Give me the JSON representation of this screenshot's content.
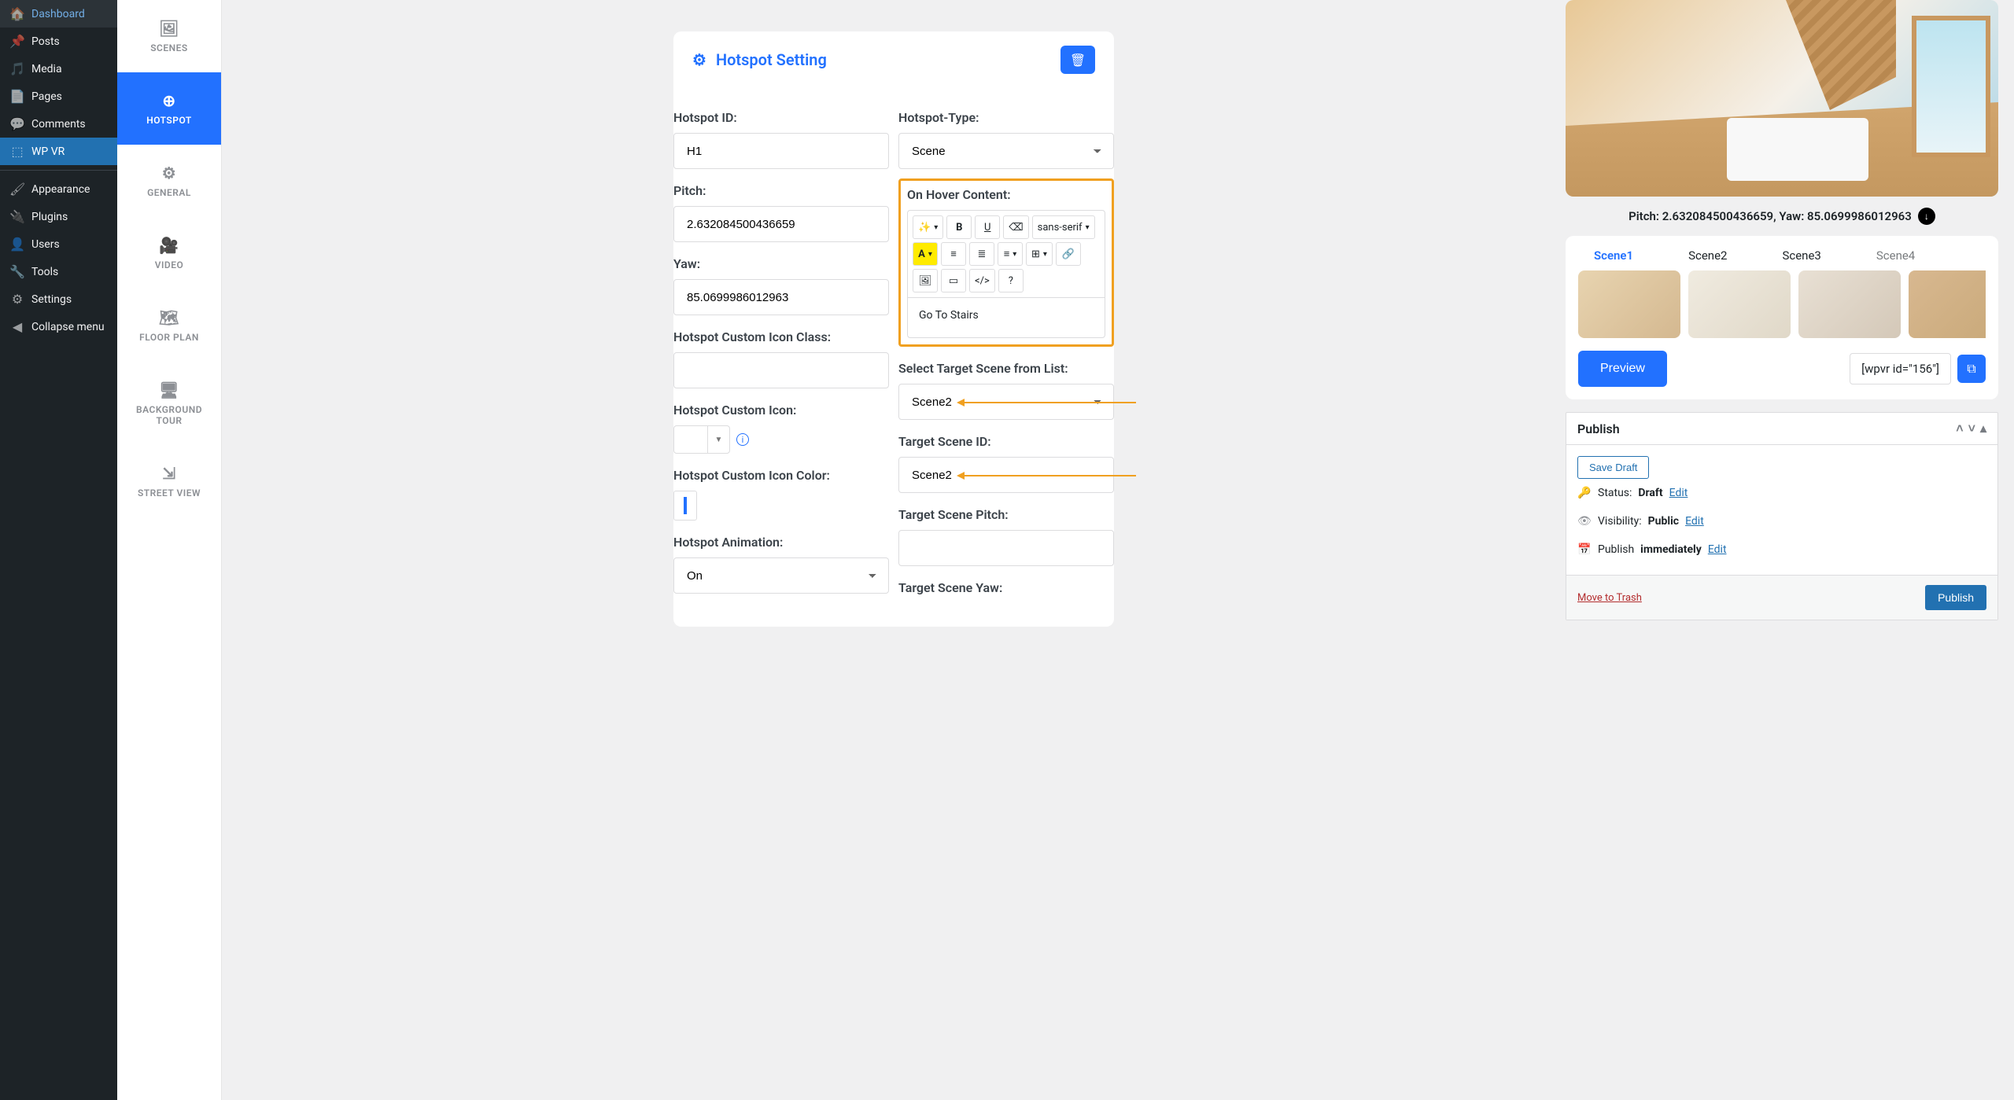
{
  "sidebar": {
    "items": [
      {
        "icon": "⌂",
        "label": "Dashboard"
      },
      {
        "icon": "📌",
        "label": "Posts"
      },
      {
        "icon": "🖼",
        "label": "Media"
      },
      {
        "icon": "📄",
        "label": "Pages"
      },
      {
        "icon": "💬",
        "label": "Comments"
      },
      {
        "icon": "⬚",
        "label": "WP VR",
        "active": true
      },
      {
        "sep": true
      },
      {
        "icon": "🖌",
        "label": "Appearance"
      },
      {
        "icon": "🔌",
        "label": "Plugins"
      },
      {
        "icon": "👤",
        "label": "Users"
      },
      {
        "icon": "🔧",
        "label": "Tools"
      },
      {
        "icon": "⚙",
        "label": "Settings"
      },
      {
        "icon": "◀",
        "label": "Collapse menu"
      }
    ]
  },
  "tabs": [
    {
      "icon": "🖼",
      "label": "SCENES"
    },
    {
      "icon": "⊕",
      "label": "HOTSPOT",
      "active": true
    },
    {
      "icon": "⚙",
      "label": "GENERAL"
    },
    {
      "icon": "🎥",
      "label": "VIDEO"
    },
    {
      "icon": "🗺",
      "label": "FLOOR PLAN"
    },
    {
      "icon": "🖥",
      "label": "BACKGROUND TOUR"
    },
    {
      "icon": "⇲",
      "label": "STREET VIEW"
    }
  ],
  "hotspot": {
    "setting_title": "Hotspot Setting",
    "id_label": "Hotspot ID:",
    "id_value": "H1",
    "type_label": "Hotspot-Type:",
    "type_value": "Scene",
    "pitch_label": "Pitch:",
    "pitch_value": "2.632084500436659",
    "yaw_label": "Yaw:",
    "yaw_value": "85.0699986012963",
    "hover_label": "On Hover Content:",
    "hover_content": "Go To Stairs",
    "icon_class_label": "Hotspot Custom Icon Class:",
    "icon_class_value": "",
    "custom_icon_label": "Hotspot Custom Icon:",
    "icon_color_label": "Hotspot Custom Icon Color:",
    "animation_label": "Hotspot Animation:",
    "animation_value": "On",
    "target_list_label": "Select Target Scene from List:",
    "target_list_value": "Scene2",
    "target_id_label": "Target Scene ID:",
    "target_id_value": "Scene2",
    "target_pitch_label": "Target Scene Pitch:",
    "target_pitch_value": "",
    "target_yaw_label": "Target Scene Yaw:"
  },
  "editor_toolbar": {
    "font": "sans-serif"
  },
  "preview": {
    "coords": "Pitch: 2.632084500436659, Yaw: 85.0699986012963",
    "scenes": [
      "Scene1",
      "Scene2",
      "Scene3",
      "Scene4"
    ],
    "preview_btn": "Preview",
    "shortcode": "[wpvr id=\"156\"]"
  },
  "publish": {
    "title": "Publish",
    "save_draft": "Save Draft",
    "status_label": "Status:",
    "status_value": "Draft",
    "visibility_label": "Visibility:",
    "visibility_value": "Public",
    "schedule_label": "Publish",
    "schedule_value": "immediately",
    "edit": "Edit",
    "trash": "Move to Trash",
    "publish_btn": "Publish"
  }
}
